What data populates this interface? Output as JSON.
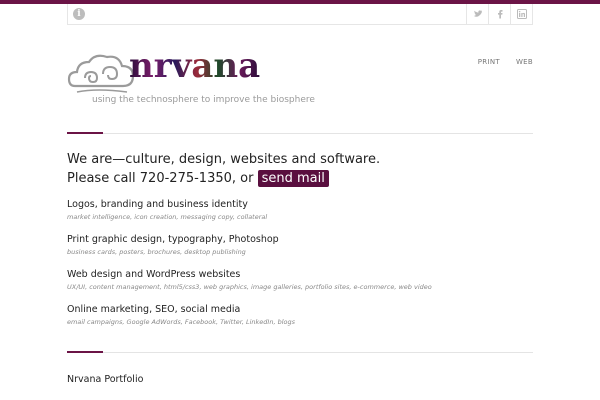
{
  "header": {
    "info_icon": "info-icon",
    "social": [
      {
        "name": "twitter-icon"
      },
      {
        "name": "facebook-icon"
      },
      {
        "name": "linkedin-icon"
      }
    ]
  },
  "logo": {
    "word": "nrvana",
    "tagline": "using the technosphere to improve the biosphere"
  },
  "nav": {
    "items": [
      {
        "label": "PRINT"
      },
      {
        "label": "WEB"
      }
    ]
  },
  "intro": {
    "line1": "We are—culture, design, websites and software.",
    "line2_prefix": "Please call 720-275-1350, or",
    "mail_label": "send mail"
  },
  "services": [
    {
      "title": "Logos, branding and business identity",
      "sub": "market intelligence, icon creation, messaging copy, collateral"
    },
    {
      "title": "Print graphic design, typography, Photoshop",
      "sub": "business cards, posters, brochures, desktop publishing"
    },
    {
      "title": "Web design and WordPress websites",
      "sub": "UX/UI, content management, html5/css3, web graphics, image galleries, portfolio sites, e-commerce, web video"
    },
    {
      "title": "Online marketing, SEO, social media",
      "sub": "email campaigns, Google AdWords, Facebook, Twitter, LinkedIn, blogs"
    }
  ],
  "portfolio": {
    "title": "Nrvana Portfolio"
  },
  "colors": {
    "brand": "#6b1446",
    "button": "#5a0f3f"
  }
}
